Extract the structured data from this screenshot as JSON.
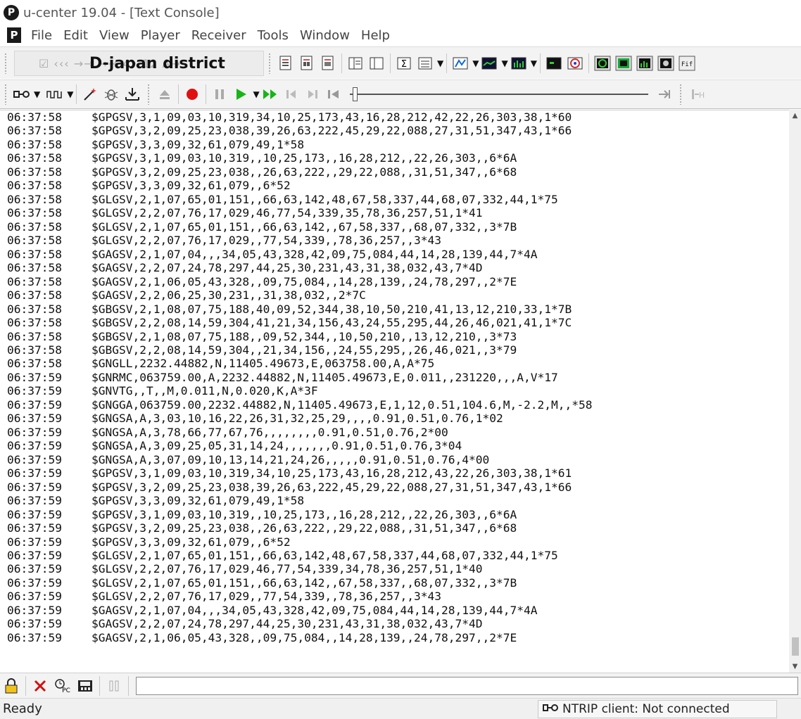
{
  "window": {
    "title": "u-center 19.04 - [Text Console]",
    "logo_letter": "P"
  },
  "menu": {
    "items": [
      "File",
      "Edit",
      "View",
      "Player",
      "Receiver",
      "Tools",
      "Window",
      "Help"
    ]
  },
  "toolbar": {
    "overlay_label": "D-japan district",
    "faint_text": "☑ ‹‹‹ →→ →→ 4• 12 A→"
  },
  "console": {
    "lines": [
      {
        "time": "06:37:58",
        "msg": "$GPGSV,3,1,09,03,10,319,34,10,25,173,43,16,28,212,42,22,26,303,38,1*60"
      },
      {
        "time": "06:37:58",
        "msg": "$GPGSV,3,2,09,25,23,038,39,26,63,222,45,29,22,088,27,31,51,347,43,1*66"
      },
      {
        "time": "06:37:58",
        "msg": "$GPGSV,3,3,09,32,61,079,49,1*58"
      },
      {
        "time": "06:37:58",
        "msg": "$GPGSV,3,1,09,03,10,319,,10,25,173,,16,28,212,,22,26,303,,6*6A"
      },
      {
        "time": "06:37:58",
        "msg": "$GPGSV,3,2,09,25,23,038,,26,63,222,,29,22,088,,31,51,347,,6*68"
      },
      {
        "time": "06:37:58",
        "msg": "$GPGSV,3,3,09,32,61,079,,6*52"
      },
      {
        "time": "06:37:58",
        "msg": "$GLGSV,2,1,07,65,01,151,,66,63,142,48,67,58,337,44,68,07,332,44,1*75"
      },
      {
        "time": "06:37:58",
        "msg": "$GLGSV,2,2,07,76,17,029,46,77,54,339,35,78,36,257,51,1*41"
      },
      {
        "time": "06:37:58",
        "msg": "$GLGSV,2,1,07,65,01,151,,66,63,142,,67,58,337,,68,07,332,,3*7B"
      },
      {
        "time": "06:37:58",
        "msg": "$GLGSV,2,2,07,76,17,029,,77,54,339,,78,36,257,,3*43"
      },
      {
        "time": "06:37:58",
        "msg": "$GAGSV,2,1,07,04,,,34,05,43,328,42,09,75,084,44,14,28,139,44,7*4A"
      },
      {
        "time": "06:37:58",
        "msg": "$GAGSV,2,2,07,24,78,297,44,25,30,231,43,31,38,032,43,7*4D"
      },
      {
        "time": "06:37:58",
        "msg": "$GAGSV,2,1,06,05,43,328,,09,75,084,,14,28,139,,24,78,297,,2*7E"
      },
      {
        "time": "06:37:58",
        "msg": "$GAGSV,2,2,06,25,30,231,,31,38,032,,2*7C"
      },
      {
        "time": "06:37:58",
        "msg": "$GBGSV,2,1,08,07,75,188,40,09,52,344,38,10,50,210,41,13,12,210,33,1*7B"
      },
      {
        "time": "06:37:58",
        "msg": "$GBGSV,2,2,08,14,59,304,41,21,34,156,43,24,55,295,44,26,46,021,41,1*7C"
      },
      {
        "time": "06:37:58",
        "msg": "$GBGSV,2,1,08,07,75,188,,09,52,344,,10,50,210,,13,12,210,,3*73"
      },
      {
        "time": "06:37:58",
        "msg": "$GBGSV,2,2,08,14,59,304,,21,34,156,,24,55,295,,26,46,021,,3*79"
      },
      {
        "time": "06:37:58",
        "msg": "$GNGLL,2232.44882,N,11405.49673,E,063758.00,A,A*75"
      },
      {
        "time": "06:37:59",
        "msg": "$GNRMC,063759.00,A,2232.44882,N,11405.49673,E,0.011,,231220,,,A,V*17"
      },
      {
        "time": "06:37:59",
        "msg": "$GNVTG,,T,,M,0.011,N,0.020,K,A*3F"
      },
      {
        "time": "06:37:59",
        "msg": "$GNGGA,063759.00,2232.44882,N,11405.49673,E,1,12,0.51,104.6,M,-2.2,M,,*58"
      },
      {
        "time": "06:37:59",
        "msg": "$GNGSA,A,3,03,10,16,22,26,31,32,25,29,,,,0.91,0.51,0.76,1*02"
      },
      {
        "time": "06:37:59",
        "msg": "$GNGSA,A,3,78,66,77,67,76,,,,,,,,0.91,0.51,0.76,2*00"
      },
      {
        "time": "06:37:59",
        "msg": "$GNGSA,A,3,09,25,05,31,14,24,,,,,,,0.91,0.51,0.76,3*04"
      },
      {
        "time": "06:37:59",
        "msg": "$GNGSA,A,3,07,09,10,13,14,21,24,26,,,,,0.91,0.51,0.76,4*00"
      },
      {
        "time": "06:37:59",
        "msg": "$GPGSV,3,1,09,03,10,319,34,10,25,173,43,16,28,212,43,22,26,303,38,1*61"
      },
      {
        "time": "06:37:59",
        "msg": "$GPGSV,3,2,09,25,23,038,39,26,63,222,45,29,22,088,27,31,51,347,43,1*66"
      },
      {
        "time": "06:37:59",
        "msg": "$GPGSV,3,3,09,32,61,079,49,1*58"
      },
      {
        "time": "06:37:59",
        "msg": "$GPGSV,3,1,09,03,10,319,,10,25,173,,16,28,212,,22,26,303,,6*6A"
      },
      {
        "time": "06:37:59",
        "msg": "$GPGSV,3,2,09,25,23,038,,26,63,222,,29,22,088,,31,51,347,,6*68"
      },
      {
        "time": "06:37:59",
        "msg": "$GPGSV,3,3,09,32,61,079,,6*52"
      },
      {
        "time": "06:37:59",
        "msg": "$GLGSV,2,1,07,65,01,151,,66,63,142,48,67,58,337,44,68,07,332,44,1*75"
      },
      {
        "time": "06:37:59",
        "msg": "$GLGSV,2,2,07,76,17,029,46,77,54,339,34,78,36,257,51,1*40"
      },
      {
        "time": "06:37:59",
        "msg": "$GLGSV,2,1,07,65,01,151,,66,63,142,,67,58,337,,68,07,332,,3*7B"
      },
      {
        "time": "06:37:59",
        "msg": "$GLGSV,2,2,07,76,17,029,,77,54,339,,78,36,257,,3*43"
      },
      {
        "time": "06:37:59",
        "msg": "$GAGSV,2,1,07,04,,,34,05,43,328,42,09,75,084,44,14,28,139,44,7*4A"
      },
      {
        "time": "06:37:59",
        "msg": "$GAGSV,2,2,07,24,78,297,44,25,30,231,43,31,38,032,43,7*4D"
      },
      {
        "time": "06:37:59",
        "msg": "$GAGSV,2,1,06,05,43,328,,09,75,084,,14,28,139,,24,78,297,,2*7E"
      }
    ]
  },
  "statusbar": {
    "left": "Ready",
    "ntrip": "NTRIP client: Not connected"
  },
  "colors": {
    "record_red": "#e01010",
    "play_green": "#18b418",
    "toolbar_bg": "#f3f3f3"
  }
}
